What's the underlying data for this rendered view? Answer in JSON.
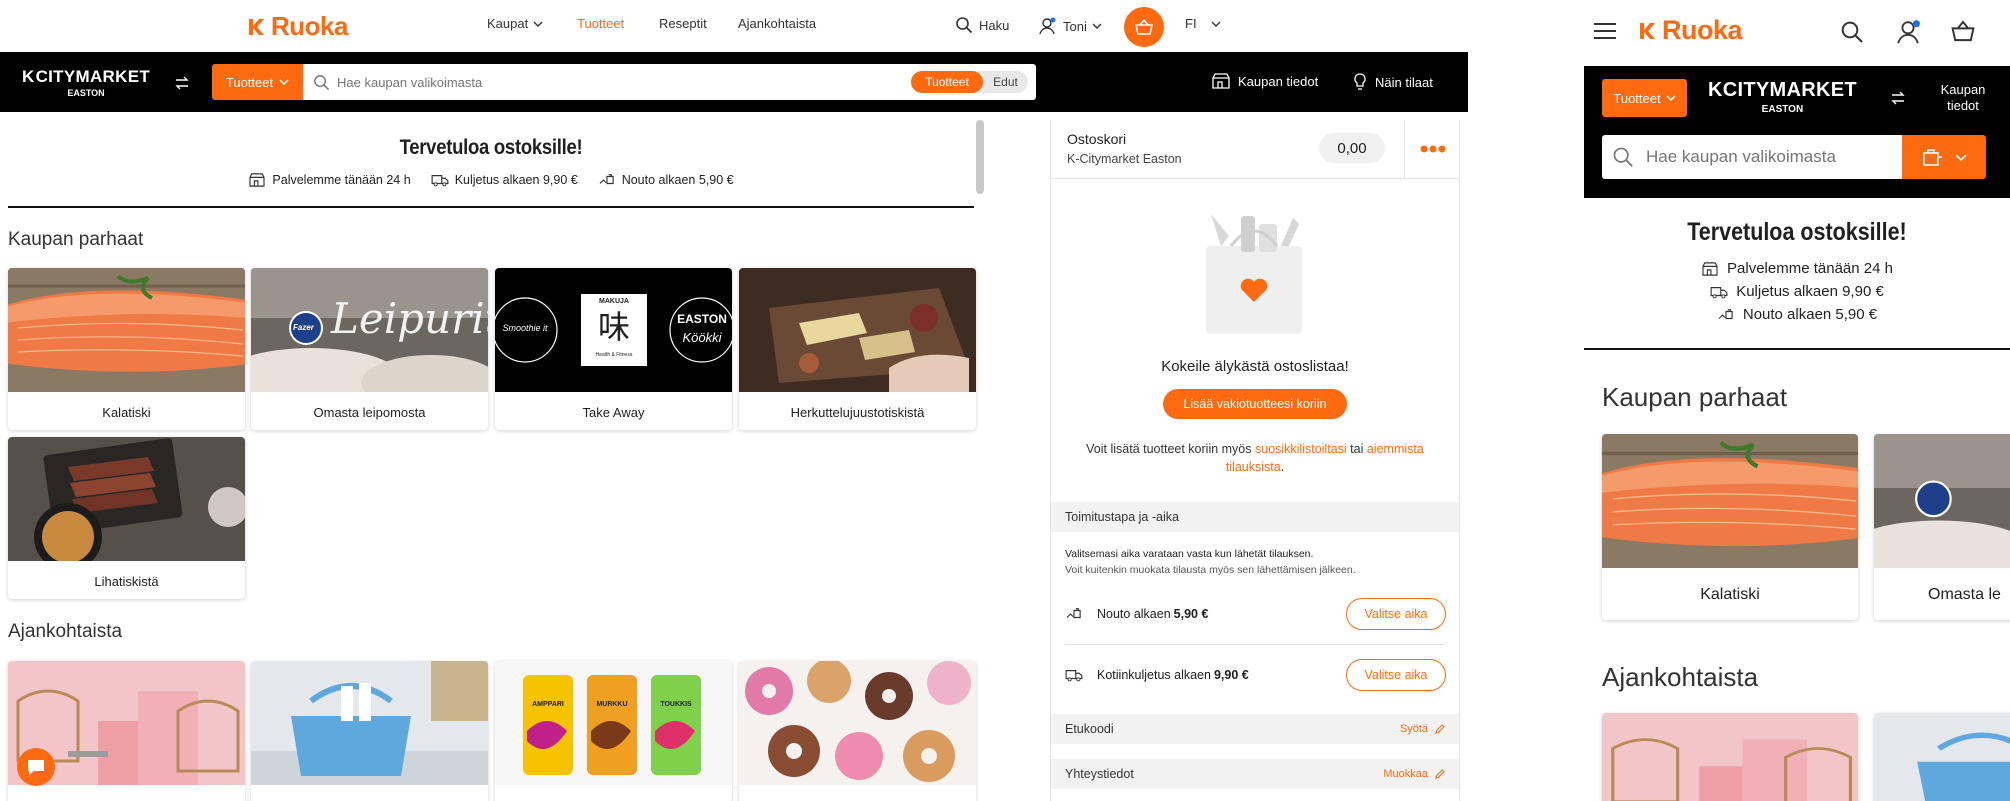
{
  "brand": {
    "name": "Ruoka",
    "accent": "#ff6a10",
    "dark": "#000000"
  },
  "desktop": {
    "topnav": {
      "kaupat": "Kaupat",
      "tuotteet": "Tuotteet",
      "reseptit": "Reseptit",
      "ajankohtaista": "Ajankohtaista",
      "haku": "Haku",
      "user": "Toni",
      "lang": "FI"
    },
    "store": {
      "name": "CITYMARKET",
      "sub": "EASTON"
    },
    "search": {
      "category_button": "Tuotteet",
      "placeholder": "Hae kaupan valikoimasta",
      "toggle_on": "Tuotteet",
      "toggle_off": "Edut"
    },
    "store_info": "Kaupan tiedot",
    "how_to_order": "Näin tilaat",
    "welcome": {
      "title": "Tervetuloa ostoksille!",
      "service": "Palvelemme tänään 24 h",
      "delivery": "Kuljetus alkaen 9,90 €",
      "pickup": "Nouto alkaen 5,90 €"
    },
    "best_title": "Kaupan parhaat",
    "best": [
      {
        "label": "Kalatiski"
      },
      {
        "label": "Omasta leipomosta"
      },
      {
        "label": "Take Away"
      },
      {
        "label": "Herkuttelujuustotiskistä"
      },
      {
        "label": "Lihatiskistä"
      }
    ],
    "bakery_text": "Leipurit",
    "bakery_badge": "Fazer",
    "takeaway": {
      "left": "Smoothie it",
      "center_top": "MAKUJA",
      "center_char": "味",
      "center_bottom": "Health & Fitness",
      "right_top": "EASTON",
      "right_bottom": "Köökki"
    },
    "news_title": "Ajankohtaista",
    "cans": [
      "AMPPARI",
      "MURKKU",
      "TOUKKIS"
    ],
    "cart": {
      "title": "Ostoskori",
      "store": "K-Citymarket Easton",
      "total": "0,00",
      "try_list": "Kokeile älykästä ostoslistaa!",
      "add_btn": "Lisää vakiotuotteesi koriin",
      "info_pre": "Voit lisätä tuotteet koriin myös ",
      "info_link1": "suosikkilistoiltasi",
      "info_mid": " tai ",
      "info_link2": "aiemmista tilauksista",
      "info_post": ".",
      "delivery_section": "Toimitustapa ja -aika",
      "note1": "Valitsemasi aika varataan vasta kun lähetät tilauksen.",
      "note2": "Voit kuitenkin muokata tilausta myös sen lähettämisen jälkeen.",
      "pickup_pre": "Nouto alkaen ",
      "pickup_price": "5,90 €",
      "home_pre": "Kotiinkuljetus alkaen ",
      "home_price": "9,90 €",
      "choose": "Valitse aika",
      "promo": "Etukoodi",
      "promo_action": "Syötä",
      "contact": "Yhteystiedot",
      "contact_action": "Muokkaa"
    }
  },
  "mobile": {
    "category_button": "Tuotteet",
    "store_info_l1": "Kaupan",
    "store_info_l2": "tiedot",
    "placeholder": "Hae kaupan valikoimasta",
    "welcome": {
      "title": "Tervetuloa ostoksille!",
      "service": "Palvelemme tänään 24 h",
      "delivery": "Kuljetus alkaen 9,90 €",
      "pickup": "Nouto alkaen 5,90 €"
    },
    "best_title": "Kaupan parhaat",
    "best": [
      {
        "label": "Kalatiski"
      },
      {
        "label": "Omasta le"
      }
    ],
    "news_title": "Ajankohtaista"
  }
}
